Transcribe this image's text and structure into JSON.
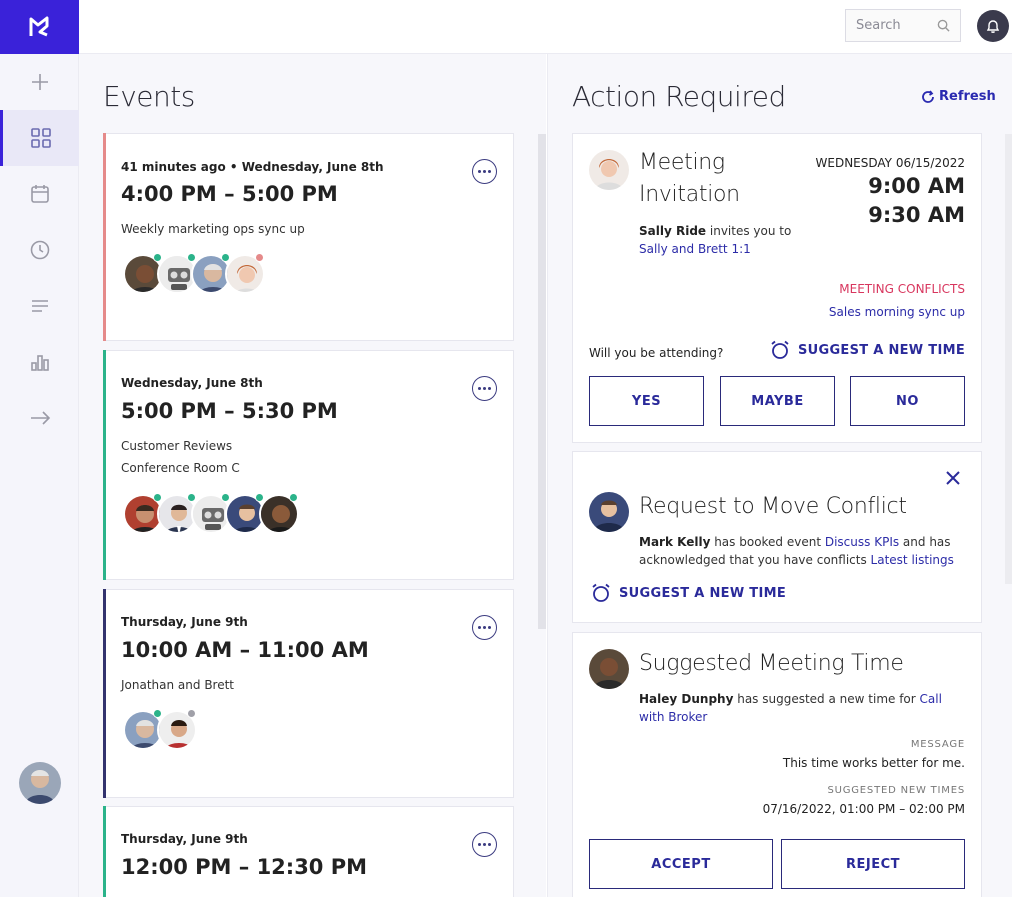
{
  "topbar": {
    "search_placeholder": "Search"
  },
  "sidebar": {
    "items": [
      "add",
      "dashboard",
      "calendar",
      "history",
      "list",
      "analytics",
      "forward"
    ],
    "active": "dashboard"
  },
  "events": {
    "title": "Events",
    "cards": [
      {
        "meta_prefix": "41 minutes ago",
        "meta_date": " • Wednesday, June 8th",
        "time": "4:00 PM – 5:00 PM",
        "lines": [
          "Weekly marketing ops sync up"
        ],
        "accent": "#e58a8a",
        "attendee_count": 4
      },
      {
        "meta_date": "Wednesday, June 8th",
        "time": "5:00 PM – 5:30 PM",
        "lines": [
          "Customer Reviews",
          "Conference Room C"
        ],
        "accent": "#2bb38a",
        "attendee_count": 5
      },
      {
        "meta_date": "Thursday, June 9th",
        "time": "10:00 AM – 11:00 AM",
        "lines": [
          "Jonathan and Brett"
        ],
        "accent": "#33336e",
        "attendee_count": 2
      },
      {
        "meta_date": "Thursday, June 9th",
        "time": "12:00 PM – 12:30 PM",
        "lines": [],
        "accent": "#2bb38a",
        "attendee_count": 0
      }
    ]
  },
  "action": {
    "title": "Action Required",
    "refresh_label": "Refresh",
    "invite": {
      "title_line1": "Meeting",
      "title_line2": "Invitation",
      "date": "WEDNESDAY 06/15/2022",
      "start": "9:00 AM",
      "end": "9:30 AM",
      "inviter": "Sally Ride",
      "invites_text": " invites you to",
      "meeting_link": "Sally and Brett 1:1",
      "conflicts_label": "MEETING CONFLICTS",
      "conflict_link": "Sales morning sync up",
      "question": "Will you be attending?",
      "suggest_label": "SUGGEST A NEW TIME",
      "yes": "YES",
      "maybe": "MAYBE",
      "no": "NO"
    },
    "move": {
      "title": "Request to Move Conflict",
      "person": "Mark Kelly",
      "text1": " has booked event ",
      "event_link": "Discuss KPIs",
      "text2": " and has acknowledged that you have conflicts ",
      "listing_link": "Latest listings",
      "suggest_label": "SUGGEST A NEW TIME"
    },
    "suggested": {
      "title": "Suggested Meeting Time",
      "person": "Haley Dunphy",
      "text1": " has suggested a new time for ",
      "event_link": "Call with Broker",
      "message_label": "MESSAGE",
      "message": "This time works better for me.",
      "new_times_label": "SUGGESTED NEW TIMES",
      "new_times": "07/16/2022, 01:00 PM – 02:00 PM",
      "accept": "ACCEPT",
      "reject": "REJECT"
    }
  },
  "colors": {
    "brand": "#3a22d9",
    "link": "#2c2ca8",
    "conflict": "#d8365e",
    "status_green": "#2bb38a"
  }
}
